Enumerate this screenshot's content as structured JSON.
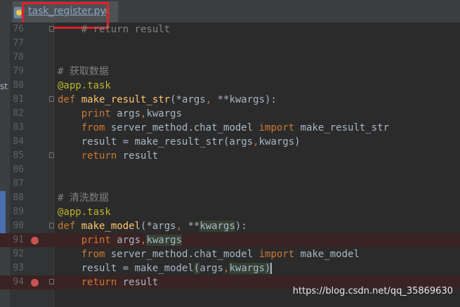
{
  "tab": {
    "filename": "task_register.py",
    "close": "×"
  },
  "sidebar": {
    "stub": "st"
  },
  "lines": [
    {
      "num": "76",
      "bp": false,
      "fold": true,
      "tokens": [
        [
          "cm",
          "    # return result"
        ]
      ]
    },
    {
      "num": "77",
      "bp": false,
      "fold": false,
      "tokens": []
    },
    {
      "num": "78",
      "bp": false,
      "fold": false,
      "tokens": []
    },
    {
      "num": "79",
      "bp": false,
      "fold": false,
      "tokens": [
        [
          "cm",
          "# 获取数据"
        ]
      ]
    },
    {
      "num": "80",
      "bp": false,
      "fold": false,
      "tokens": [
        [
          "dec",
          "@app.task"
        ]
      ]
    },
    {
      "num": "81",
      "bp": false,
      "fold": true,
      "tokens": [
        [
          "kw",
          "def "
        ],
        [
          "fn",
          "make_result_str"
        ],
        [
          "",
          "(*args"
        ],
        [
          "kw",
          ", "
        ],
        [
          "",
          "**kwargs):"
        ]
      ]
    },
    {
      "num": "82",
      "bp": false,
      "fold": false,
      "tokens": [
        [
          "",
          "    "
        ],
        [
          "kw",
          "print "
        ],
        [
          "",
          "args"
        ],
        [
          "kw",
          ","
        ],
        [
          "",
          "kwargs"
        ]
      ]
    },
    {
      "num": "83",
      "bp": false,
      "fold": false,
      "tokens": [
        [
          "",
          "    "
        ],
        [
          "kw",
          "from "
        ],
        [
          "",
          "server_method.chat_model "
        ],
        [
          "kw",
          "import "
        ],
        [
          "",
          "make_result_str"
        ]
      ]
    },
    {
      "num": "84",
      "bp": false,
      "fold": false,
      "tokens": [
        [
          "",
          "    result = make_result_str(args"
        ],
        [
          "kw",
          ","
        ],
        [
          "",
          "kwargs)"
        ]
      ]
    },
    {
      "num": "85",
      "bp": false,
      "fold": true,
      "tokens": [
        [
          "",
          "    "
        ],
        [
          "kw",
          "return "
        ],
        [
          "",
          "result"
        ]
      ]
    },
    {
      "num": "86",
      "bp": false,
      "fold": false,
      "tokens": []
    },
    {
      "num": "87",
      "bp": false,
      "fold": false,
      "tokens": []
    },
    {
      "num": "88",
      "bp": false,
      "fold": false,
      "tokens": [
        [
          "cm",
          "# 清洗数据"
        ]
      ]
    },
    {
      "num": "89",
      "bp": false,
      "fold": false,
      "tokens": [
        [
          "dec",
          "@app.task"
        ]
      ]
    },
    {
      "num": "90",
      "bp": false,
      "fold": true,
      "tokens": [
        [
          "kw",
          "def "
        ],
        [
          "fn",
          "make_model"
        ],
        [
          "",
          "(*args"
        ],
        [
          "kw",
          ", "
        ],
        [
          "",
          "**"
        ],
        [
          "hl",
          "kwargs"
        ],
        [
          "",
          "):"
        ]
      ]
    },
    {
      "num": "91",
      "bp": true,
      "fold": false,
      "tokens": [
        [
          "",
          "    "
        ],
        [
          "kw",
          "print "
        ],
        [
          "",
          "args"
        ],
        [
          "kw",
          ","
        ],
        [
          "hl",
          "kwargs"
        ]
      ]
    },
    {
      "num": "92",
      "bp": false,
      "fold": false,
      "tokens": [
        [
          "",
          "    "
        ],
        [
          "kw",
          "from "
        ],
        [
          "",
          "server_method.chat_model "
        ],
        [
          "kw",
          "import "
        ],
        [
          "",
          "make_model"
        ]
      ]
    },
    {
      "num": "93",
      "bp": false,
      "fold": false,
      "tokens": [
        [
          "",
          "    result = make_model"
        ],
        [
          "hl",
          "("
        ],
        [
          "",
          "args"
        ],
        [
          "kw",
          ","
        ],
        [
          "hl",
          "kwargs"
        ],
        [
          "hl",
          ")"
        ],
        [
          "caret",
          ""
        ]
      ]
    },
    {
      "num": "94",
      "bp": true,
      "fold": true,
      "tokens": [
        [
          "",
          "    "
        ],
        [
          "kw",
          "return "
        ],
        [
          "",
          "result"
        ]
      ]
    }
  ],
  "watermark": "https://blog.csdn.net/qq_35869630"
}
